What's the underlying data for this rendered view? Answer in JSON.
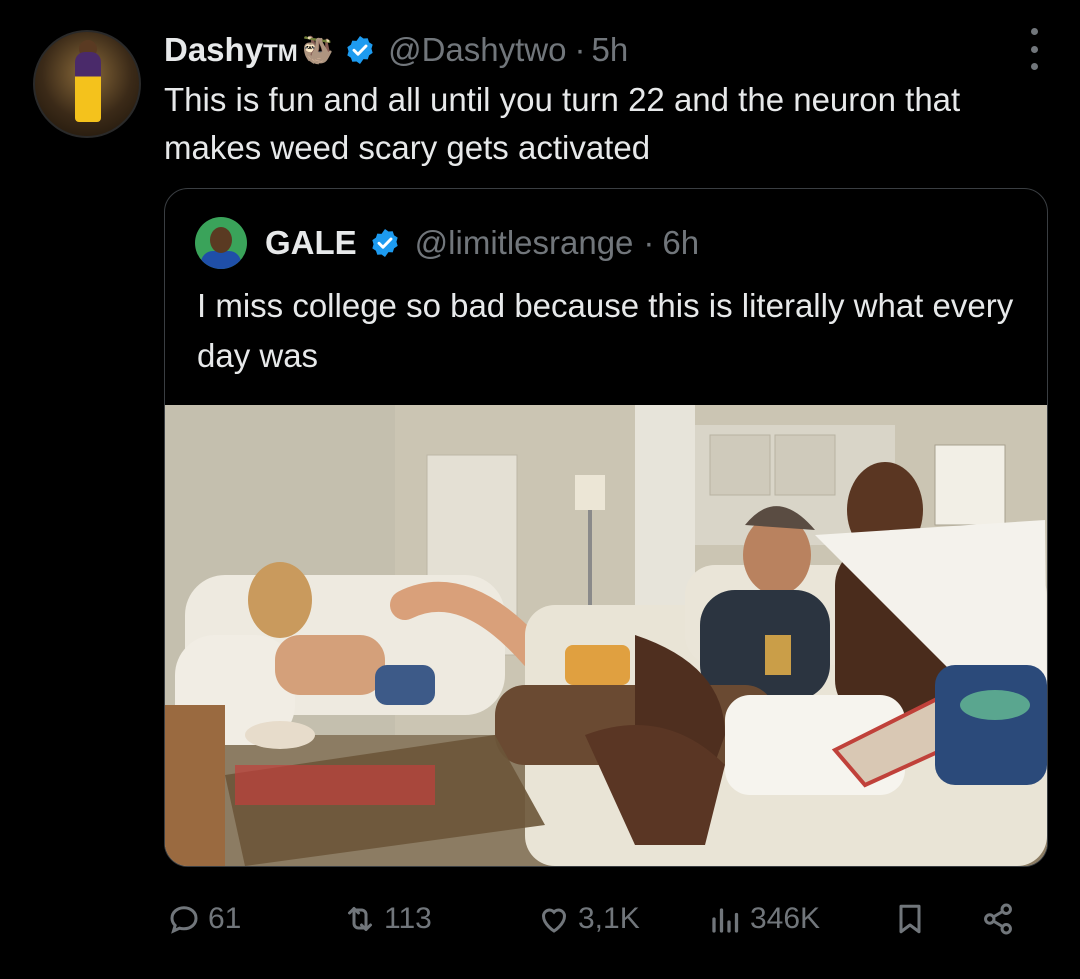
{
  "tweet": {
    "author_name": "Dashy",
    "author_suffix": "TM",
    "author_emoji": "🦥",
    "handle": "@Dashytwo",
    "separator": "·",
    "time": "5h",
    "text": "This is fun and all until you turn 22 and the neuron that makes weed scary gets activated"
  },
  "quoted": {
    "author_name": "GALE",
    "handle": "@limitlesrange",
    "separator": "·",
    "time": "6h",
    "text": "I miss college so bad because this is literally what every day was"
  },
  "actions": {
    "replies": "61",
    "reposts": "113",
    "likes": "3,1K",
    "views": "346K"
  },
  "icons": [
    "more-icon",
    "verified-icon",
    "reply-icon",
    "repost-icon",
    "like-icon",
    "views-icon",
    "bookmark-icon",
    "share-icon"
  ],
  "colors": {
    "background": "#000000",
    "text": "#e7e9ea",
    "muted": "#71767b",
    "verified": "#1d9bf0",
    "border": "#3a3e42"
  }
}
